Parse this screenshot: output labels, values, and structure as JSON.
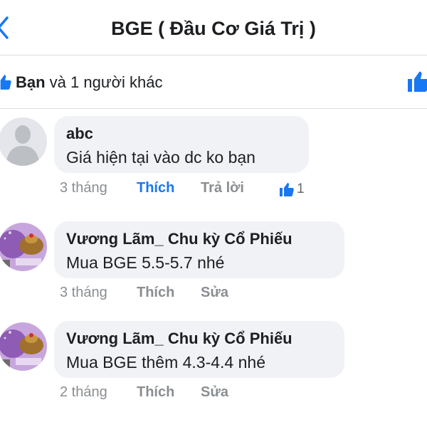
{
  "header": {
    "title": "BGE ( Đầu Cơ Giá Trị )",
    "icons": {
      "back": "chevron-left-icon"
    }
  },
  "likes": {
    "bold_name": "Bạn",
    "rest_text": " và 1 người khác",
    "icons": {
      "left": "thumbs-up-icon",
      "right": "thumbs-up-icon"
    }
  },
  "comments": [
    {
      "author": "abc",
      "text": "Giá hiện tại vào dc ko bạn",
      "time": "3 tháng",
      "like_label": "Thích",
      "like_active": true,
      "third_action": "Trả lời",
      "reaction_count": "1",
      "avatar": "default-user-avatar"
    },
    {
      "author": "Vương Lãm_ Chu kỳ Cổ Phiếu",
      "text": "Mua BGE 5.5-5.7 nhé",
      "time": "3 tháng",
      "like_label": "Thích",
      "like_active": false,
      "third_action": "Sửa",
      "avatar": "purple-profile-avatar"
    },
    {
      "author": "Vương Lãm_ Chu kỳ Cổ Phiếu",
      "text": "Mua BGE thêm 4.3-4.4 nhé",
      "time": "2 tháng",
      "like_label": "Thích",
      "like_active": false,
      "third_action": "Sửa",
      "avatar": "purple-profile-avatar"
    }
  ],
  "colors": {
    "accent": "#1877f2",
    "bubble": "#f0f2f5",
    "secondary_text": "#8a8d91",
    "divider": "#dadde1"
  }
}
